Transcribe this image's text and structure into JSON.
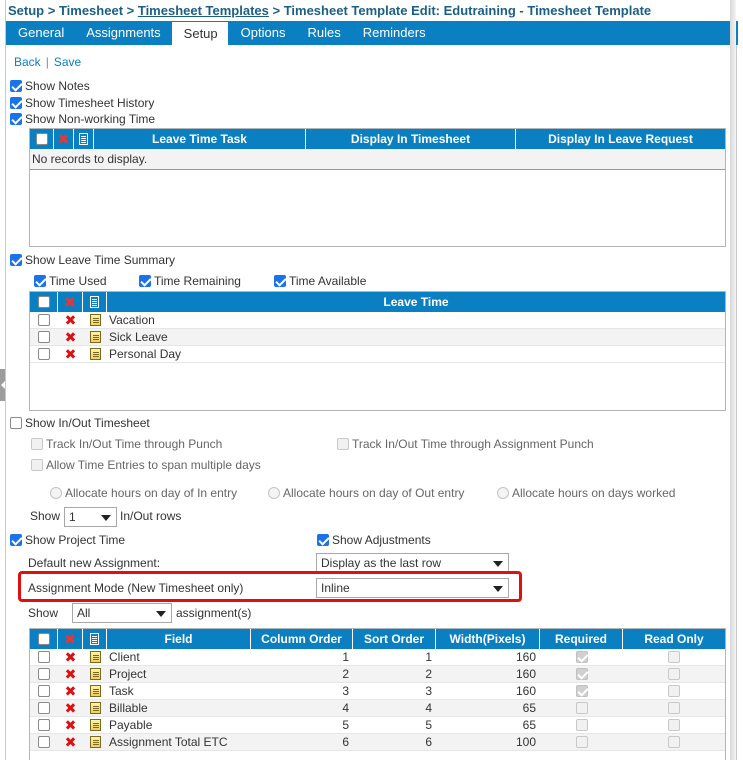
{
  "breadcrumb": {
    "root": "Setup",
    "sep": " > ",
    "timesheet": "Timesheet",
    "templates": "Timesheet Templates",
    "current": "Timesheet Template Edit: Edutraining - Timesheet Template"
  },
  "tabs": [
    "General",
    "Assignments",
    "Setup",
    "Options",
    "Rules",
    "Reminders"
  ],
  "actions": {
    "back": "Back",
    "sep": "|",
    "save": "Save"
  },
  "options": {
    "show_notes": "Show Notes",
    "show_history": "Show Timesheet History",
    "show_nonworking": "Show Non-working Time",
    "show_leave_summary": "Show Leave Time Summary",
    "time_used": "Time Used",
    "time_remaining": "Time Remaining",
    "time_available": "Time Available",
    "show_inout": "Show In/Out Timesheet",
    "track_punch": "Track In/Out Time through Punch",
    "track_assignment_punch": "Track In/Out Time through Assignment Punch",
    "allow_span": "Allow Time Entries to span multiple days",
    "alloc_in": "Allocate hours on day of In entry",
    "alloc_out": "Allocate hours on day of Out entry",
    "alloc_days": "Allocate hours on days worked",
    "show_label": "Show",
    "show_rows_value": "1",
    "inout_rows": "In/Out rows",
    "show_project_time": "Show Project Time",
    "show_adjustments": "Show Adjustments",
    "default_new_assignment_label": "Default new Assignment:",
    "default_new_assignment_value": "Display as the last row",
    "assignment_mode_label": "Assignment Mode (New Timesheet only)",
    "assignment_mode_value": "Inline",
    "show_assign_value": "All",
    "assignments_suffix": "assignment(s)"
  },
  "leave_task_grid": {
    "headers": [
      "Leave Time Task",
      "Display In Timesheet",
      "Display In Leave Request"
    ],
    "empty": "No records to display."
  },
  "leave_time_grid": {
    "header": "Leave Time",
    "rows": [
      "Vacation",
      "Sick Leave",
      "Personal Day"
    ]
  },
  "field_grid": {
    "headers": [
      "Field",
      "Column Order",
      "Sort Order",
      "Width(Pixels)",
      "Required",
      "Read Only"
    ],
    "rows": [
      {
        "field": "Client",
        "col": "1",
        "sort": "1",
        "width": "160",
        "required": true
      },
      {
        "field": "Project",
        "col": "2",
        "sort": "2",
        "width": "160",
        "required": true
      },
      {
        "field": "Task",
        "col": "3",
        "sort": "3",
        "width": "160",
        "required": true
      },
      {
        "field": "Billable",
        "col": "4",
        "sort": "4",
        "width": "65",
        "required": false
      },
      {
        "field": "Payable",
        "col": "5",
        "sort": "5",
        "width": "65",
        "required": false
      },
      {
        "field": "Assignment Total ETC",
        "col": "6",
        "sort": "6",
        "width": "100",
        "required": false
      }
    ]
  },
  "colors": {
    "accent": "#0a7fc1",
    "highlight": "#e01010"
  }
}
